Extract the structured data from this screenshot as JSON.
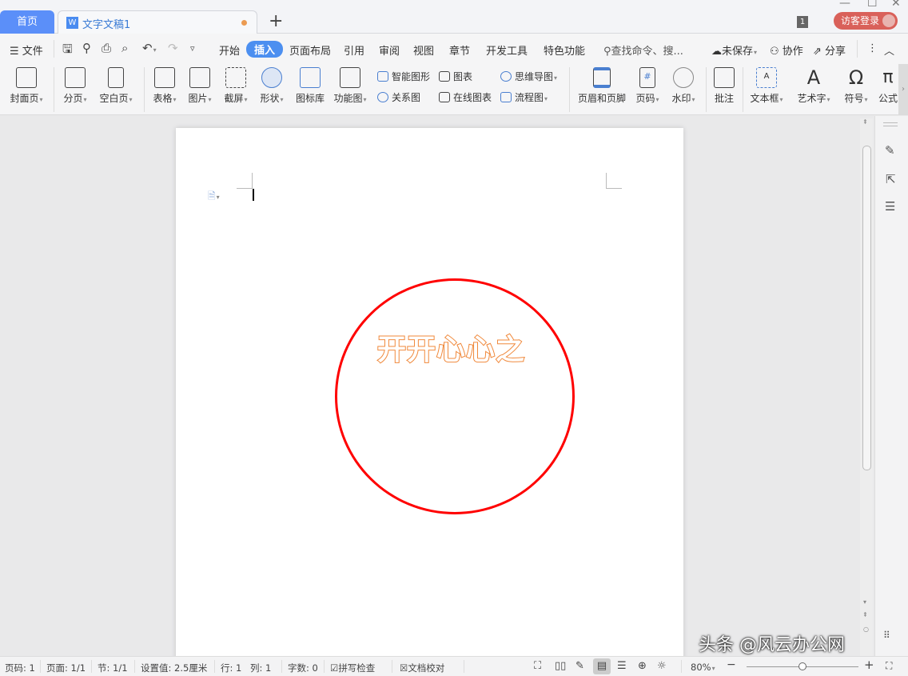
{
  "tabs": {
    "home": "首页",
    "doc": "文字文稿1",
    "doc_icon": "W"
  },
  "account": {
    "count": "1",
    "login": "访客登录"
  },
  "menu": {
    "file": "文件",
    "items": [
      "开始",
      "插入",
      "页面布局",
      "引用",
      "审阅",
      "视图",
      "章节",
      "开发工具",
      "特色功能"
    ],
    "active": "插入",
    "search": "查找命令、搜...",
    "unsaved": "未保存",
    "collab": "协作",
    "share": "分享"
  },
  "ribbon": {
    "large": [
      "封面页",
      "分页",
      "空白页",
      "表格",
      "图片",
      "截屏",
      "形状",
      "图标库",
      "功能图",
      "页眉和页脚",
      "页码",
      "水印",
      "批注",
      "文本框",
      "艺术字",
      "符号",
      "公式"
    ],
    "small": [
      "智能图形",
      "关系图",
      "图表",
      "在线图表",
      "思维导图",
      "流程图"
    ]
  },
  "document": {
    "art_text": "开开心心之",
    "shape_color": "#ff0000",
    "text_color": "#f0883a"
  },
  "status": {
    "page_no": "页码: 1",
    "pages": "页面: 1/1",
    "section": "节: 1/1",
    "setting": "设置值: 2.5厘米",
    "row": "行: 1",
    "col": "列: 1",
    "words": "字数: 0",
    "spell": "拼写检查",
    "proof": "文档校对",
    "zoom": "80%",
    "zoom_fraction": 0.5
  },
  "watermark": "头条 @风云办公网"
}
